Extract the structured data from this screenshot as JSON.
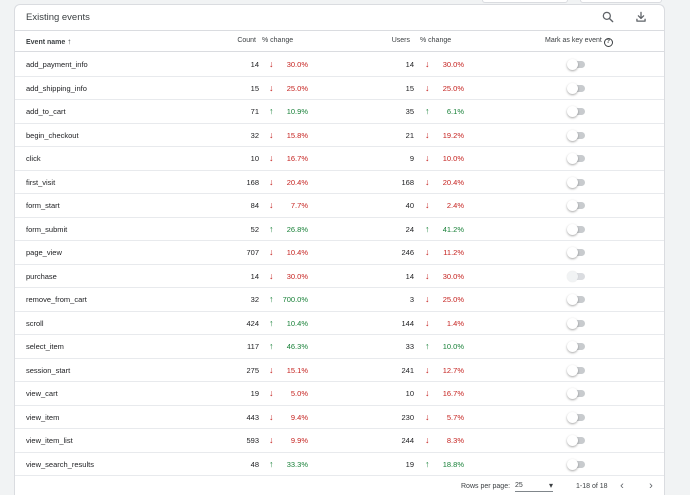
{
  "panel": {
    "title": "Existing events",
    "icons": {
      "search": "search-icon",
      "download": "download-icon"
    }
  },
  "columns": {
    "event_name": "Event name",
    "sort_indicator": "↑",
    "count": "Count",
    "count_change": "% change",
    "users": "Users",
    "users_change": "% change",
    "mark_key": "Mark as key event",
    "help": "?"
  },
  "rows": [
    {
      "name": "add_payment_info",
      "count": "14",
      "count_dir": "down",
      "count_arrow": "↓",
      "count_pct": "30.0%",
      "users": "14",
      "users_dir": "down",
      "users_arrow": "↓",
      "users_pct": "30.0%",
      "key_event": false,
      "disabled": false
    },
    {
      "name": "add_shipping_info",
      "count": "15",
      "count_dir": "down",
      "count_arrow": "↓",
      "count_pct": "25.0%",
      "users": "15",
      "users_dir": "down",
      "users_arrow": "↓",
      "users_pct": "25.0%",
      "key_event": false,
      "disabled": false
    },
    {
      "name": "add_to_cart",
      "count": "71",
      "count_dir": "up",
      "count_arrow": "↑",
      "count_pct": "10.9%",
      "users": "35",
      "users_dir": "up",
      "users_arrow": "↑",
      "users_pct": "6.1%",
      "key_event": false,
      "disabled": false
    },
    {
      "name": "begin_checkout",
      "count": "32",
      "count_dir": "down",
      "count_arrow": "↓",
      "count_pct": "15.8%",
      "users": "21",
      "users_dir": "down",
      "users_arrow": "↓",
      "users_pct": "19.2%",
      "key_event": false,
      "disabled": false
    },
    {
      "name": "click",
      "count": "10",
      "count_dir": "down",
      "count_arrow": "↓",
      "count_pct": "16.7%",
      "users": "9",
      "users_dir": "down",
      "users_arrow": "↓",
      "users_pct": "10.0%",
      "key_event": false,
      "disabled": false
    },
    {
      "name": "first_visit",
      "count": "168",
      "count_dir": "down",
      "count_arrow": "↓",
      "count_pct": "20.4%",
      "users": "168",
      "users_dir": "down",
      "users_arrow": "↓",
      "users_pct": "20.4%",
      "key_event": false,
      "disabled": false
    },
    {
      "name": "form_start",
      "count": "84",
      "count_dir": "down",
      "count_arrow": "↓",
      "count_pct": "7.7%",
      "users": "40",
      "users_dir": "down",
      "users_arrow": "↓",
      "users_pct": "2.4%",
      "key_event": false,
      "disabled": false
    },
    {
      "name": "form_submit",
      "count": "52",
      "count_dir": "up",
      "count_arrow": "↑",
      "count_pct": "26.8%",
      "users": "24",
      "users_dir": "up",
      "users_arrow": "↑",
      "users_pct": "41.2%",
      "key_event": false,
      "disabled": false
    },
    {
      "name": "page_view",
      "count": "707",
      "count_dir": "down",
      "count_arrow": "↓",
      "count_pct": "10.4%",
      "users": "246",
      "users_dir": "down",
      "users_arrow": "↓",
      "users_pct": "11.2%",
      "key_event": false,
      "disabled": false
    },
    {
      "name": "purchase",
      "count": "14",
      "count_dir": "down",
      "count_arrow": "↓",
      "count_pct": "30.0%",
      "users": "14",
      "users_dir": "down",
      "users_arrow": "↓",
      "users_pct": "30.0%",
      "key_event": true,
      "disabled": true
    },
    {
      "name": "remove_from_cart",
      "count": "32",
      "count_dir": "up",
      "count_arrow": "↑",
      "count_pct": "700.0%",
      "users": "3",
      "users_dir": "down",
      "users_arrow": "↓",
      "users_pct": "25.0%",
      "key_event": false,
      "disabled": false
    },
    {
      "name": "scroll",
      "count": "424",
      "count_dir": "up",
      "count_arrow": "↑",
      "count_pct": "10.4%",
      "users": "144",
      "users_dir": "down",
      "users_arrow": "↓",
      "users_pct": "1.4%",
      "key_event": false,
      "disabled": false
    },
    {
      "name": "select_item",
      "count": "117",
      "count_dir": "up",
      "count_arrow": "↑",
      "count_pct": "46.3%",
      "users": "33",
      "users_dir": "up",
      "users_arrow": "↑",
      "users_pct": "10.0%",
      "key_event": false,
      "disabled": false
    },
    {
      "name": "session_start",
      "count": "275",
      "count_dir": "down",
      "count_arrow": "↓",
      "count_pct": "15.1%",
      "users": "241",
      "users_dir": "down",
      "users_arrow": "↓",
      "users_pct": "12.7%",
      "key_event": false,
      "disabled": false
    },
    {
      "name": "view_cart",
      "count": "19",
      "count_dir": "down",
      "count_arrow": "↓",
      "count_pct": "5.0%",
      "users": "10",
      "users_dir": "down",
      "users_arrow": "↓",
      "users_pct": "16.7%",
      "key_event": false,
      "disabled": false
    },
    {
      "name": "view_item",
      "count": "443",
      "count_dir": "down",
      "count_arrow": "↓",
      "count_pct": "9.4%",
      "users": "230",
      "users_dir": "down",
      "users_arrow": "↓",
      "users_pct": "5.7%",
      "key_event": false,
      "disabled": false
    },
    {
      "name": "view_item_list",
      "count": "593",
      "count_dir": "down",
      "count_arrow": "↓",
      "count_pct": "9.9%",
      "users": "244",
      "users_dir": "down",
      "users_arrow": "↓",
      "users_pct": "8.3%",
      "key_event": false,
      "disabled": false
    },
    {
      "name": "view_search_results",
      "count": "48",
      "count_dir": "up",
      "count_arrow": "↑",
      "count_pct": "33.3%",
      "users": "19",
      "users_dir": "up",
      "users_arrow": "↑",
      "users_pct": "18.8%",
      "key_event": false,
      "disabled": false
    }
  ],
  "footer": {
    "rows_per_page_label": "Rows per page:",
    "rows_per_page_value": "25",
    "dropdown_caret": "▾",
    "range": "1-18 of 18",
    "prev": "‹",
    "next": "›"
  },
  "colors": {
    "down": "#c5221f",
    "up": "#188038",
    "border": "#dadce0"
  }
}
